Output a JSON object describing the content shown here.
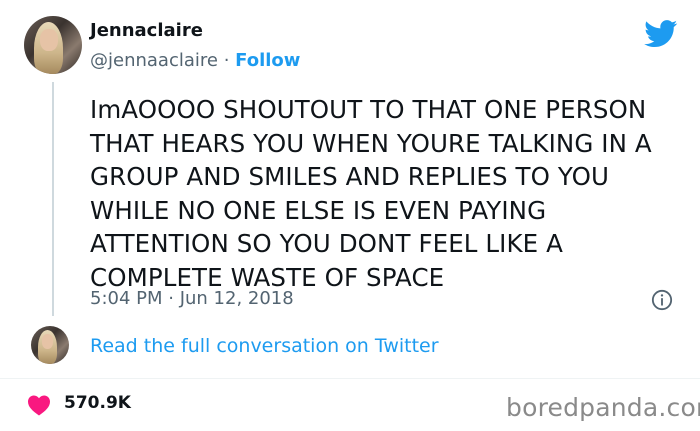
{
  "author": {
    "name": "Jennaclaire",
    "handle": "@jennaaclaire",
    "separator": " · ",
    "follow_label": "Follow"
  },
  "tweet": {
    "lines": [
      "ImAOOOO SHOUTOUT TO THAT ONE PERSON",
      "THAT HEARS YOU WHEN YOURE TALKING IN A",
      "GROUP AND SMILES AND REPLIES TO YOU",
      "WHILE NO ONE ELSE IS EVEN PAYING",
      "ATTENTION SO YOU DONT FEEL LIKE A",
      "COMPLETE WASTE OF SPACE"
    ],
    "timestamp": "5:04 PM · Jun 12, 2018"
  },
  "conversation_link": "Read the full conversation on Twitter",
  "likes": "570.9K",
  "watermark": "boredpanda.com",
  "colors": {
    "accent": "#1d9bf0",
    "heart": "#f91880",
    "text": "#0f1419",
    "muted": "#536471"
  },
  "icons": [
    "twitter-bird-icon",
    "info-icon",
    "heart-icon"
  ]
}
